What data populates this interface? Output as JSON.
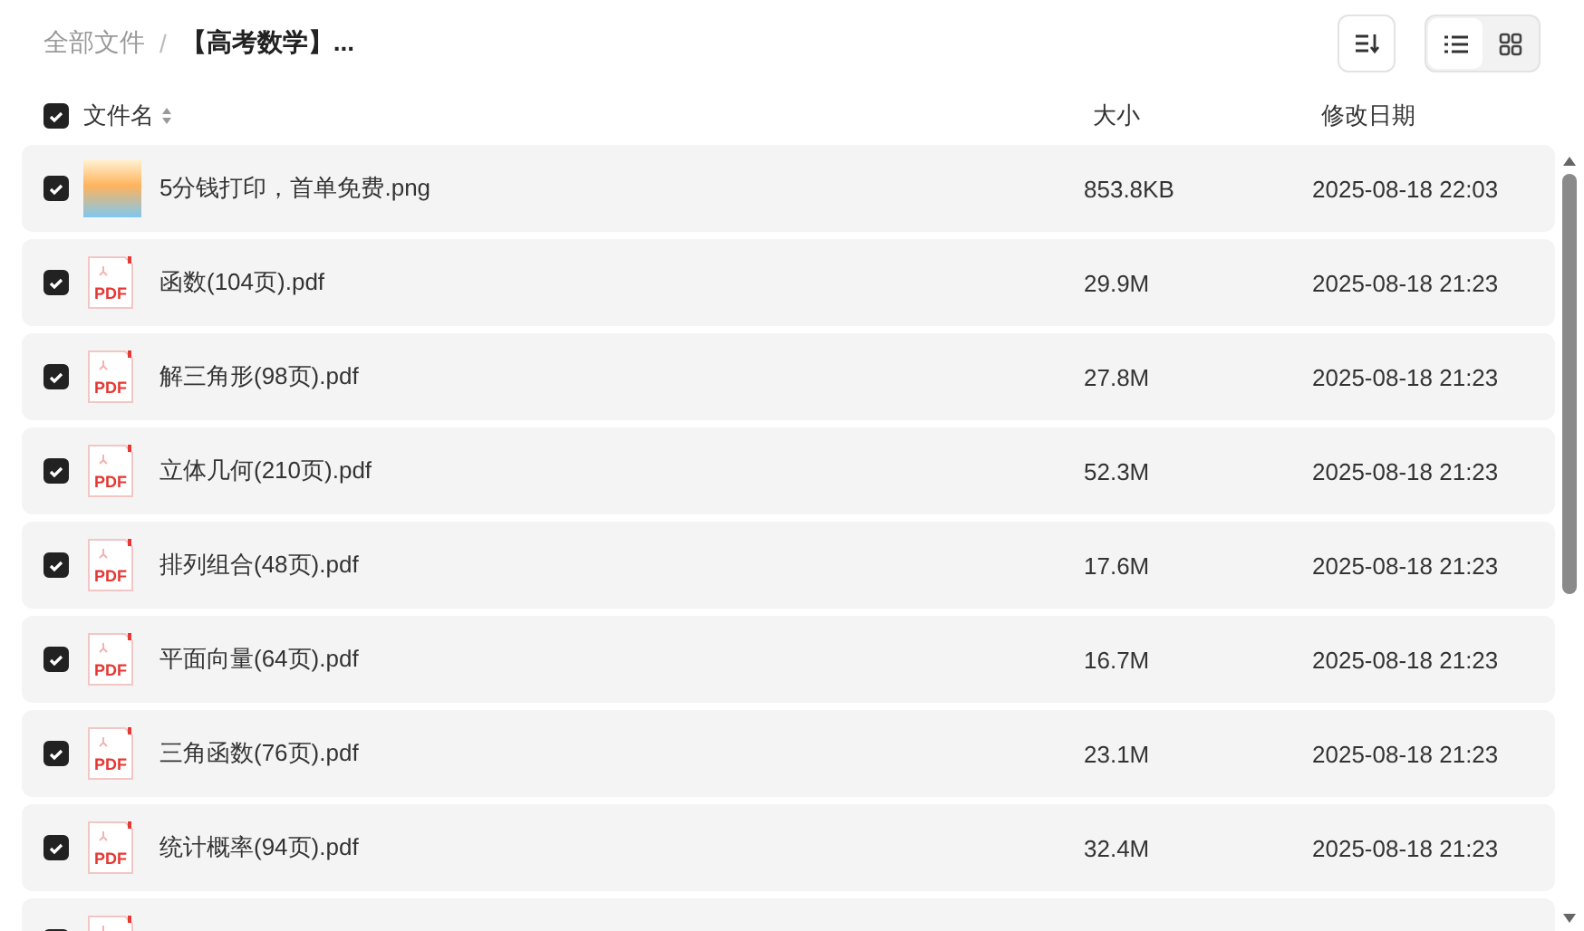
{
  "breadcrumb": {
    "root": "全部文件",
    "separator": "/",
    "current": "【高考数学】..."
  },
  "view_modes": [
    {
      "kind": "list",
      "selected": true
    },
    {
      "kind": "grid",
      "selected": false
    }
  ],
  "header": {
    "checked": true,
    "name": "文件名",
    "size": "大小",
    "date": "修改日期"
  },
  "files": [
    {
      "kind": "image",
      "checked": true,
      "name": "5分钱打印，首单免费.png",
      "size": "853.8KB",
      "date": "2025-08-18 22:03"
    },
    {
      "kind": "pdf",
      "icon_label": "PDF",
      "checked": true,
      "name": "函数(104页).pdf",
      "size": "29.9M",
      "date": "2025-08-18 21:23"
    },
    {
      "kind": "pdf",
      "icon_label": "PDF",
      "checked": true,
      "name": "解三角形(98页).pdf",
      "size": "27.8M",
      "date": "2025-08-18 21:23"
    },
    {
      "kind": "pdf",
      "icon_label": "PDF",
      "checked": true,
      "name": "立体几何(210页).pdf",
      "size": "52.3M",
      "date": "2025-08-18 21:23"
    },
    {
      "kind": "pdf",
      "icon_label": "PDF",
      "checked": true,
      "name": "排列组合(48页).pdf",
      "size": "17.6M",
      "date": "2025-08-18 21:23"
    },
    {
      "kind": "pdf",
      "icon_label": "PDF",
      "checked": true,
      "name": "平面向量(64页).pdf",
      "size": "16.7M",
      "date": "2025-08-18 21:23"
    },
    {
      "kind": "pdf",
      "icon_label": "PDF",
      "checked": true,
      "name": "三角函数(76页).pdf",
      "size": "23.1M",
      "date": "2025-08-18 21:23"
    },
    {
      "kind": "pdf",
      "icon_label": "PDF",
      "checked": true,
      "name": "统计概率(94页).pdf",
      "size": "32.4M",
      "date": "2025-08-18 21:23"
    },
    {
      "kind": "pdf",
      "checked": true
    }
  ]
}
